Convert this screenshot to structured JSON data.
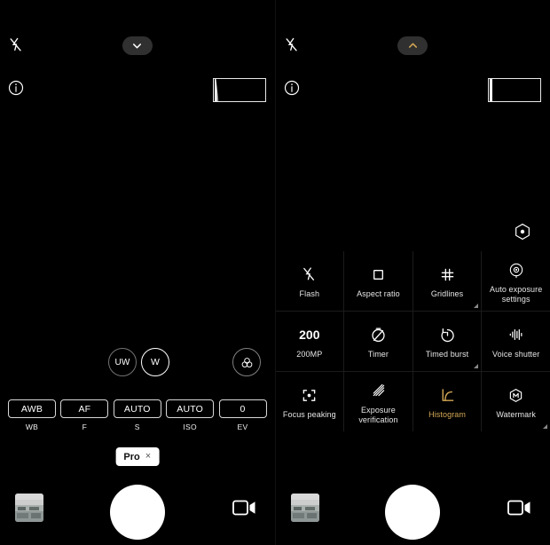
{
  "left_panel": {
    "top_bar": {
      "flash_icon": "flash-off-icon",
      "info_icon": "info-icon",
      "expand_toggle": {
        "icon": "chevron-down-icon",
        "state": "collapsed"
      },
      "histogram_overlay": "histogram-overlay"
    },
    "zoom": {
      "options": [
        {
          "label": "UW",
          "selected": false
        },
        {
          "label": "W",
          "selected": true
        }
      ],
      "filter_icon": "filters-icon"
    },
    "pro_controls": [
      {
        "value": "AWB",
        "label": "WB"
      },
      {
        "value": "AF",
        "label": "F"
      },
      {
        "value": "AUTO",
        "label": "S"
      },
      {
        "value": "AUTO",
        "label": "ISO"
      },
      {
        "value": "0",
        "label": "EV"
      }
    ],
    "mode_chip": {
      "label": "Pro",
      "close": "×"
    },
    "shutter_bar": {
      "gallery_icon": "gallery-thumbnail",
      "shutter_icon": "shutter-button",
      "video_icon": "video-camera-icon"
    }
  },
  "right_panel": {
    "top_bar": {
      "flash_icon": "flash-off-icon",
      "info_icon": "info-icon",
      "expand_toggle": {
        "icon": "chevron-up-icon",
        "state": "expanded"
      },
      "histogram_overlay": "histogram-overlay"
    },
    "ae_shortcut_icon": "auto-exposure-icon",
    "settings_grid": [
      [
        {
          "label": "Flash",
          "icon": "flash-off-icon",
          "active": false,
          "has_corner": false
        },
        {
          "label": "Aspect ratio",
          "icon": "square-icon",
          "active": false,
          "has_corner": false
        },
        {
          "label": "Gridlines",
          "icon": "gridlines-icon",
          "active": false,
          "has_corner": true
        },
        {
          "label": "Auto exposure settings",
          "icon": "auto-exposure-icon",
          "active": false,
          "has_corner": false
        }
      ],
      [
        {
          "label": "200MP",
          "icon": "200",
          "icon_type": "text",
          "active": false,
          "has_corner": false
        },
        {
          "label": "Timer",
          "icon": "timer-off-icon",
          "active": false,
          "has_corner": false
        },
        {
          "label": "Timed burst",
          "icon": "timed-burst-icon",
          "active": false,
          "has_corner": true
        },
        {
          "label": "Voice shutter",
          "icon": "voice-shutter-icon",
          "active": false,
          "has_corner": false
        }
      ],
      [
        {
          "label": "Focus peaking",
          "icon": "focus-peaking-icon",
          "active": false,
          "has_corner": false
        },
        {
          "label": "Exposure verification",
          "icon": "exposure-verification-icon",
          "active": false,
          "has_corner": false
        },
        {
          "label": "Histogram",
          "icon": "histogram-icon",
          "active": true,
          "has_corner": false
        },
        {
          "label": "Watermark",
          "icon": "watermark-icon",
          "active": false,
          "has_corner": true
        }
      ]
    ],
    "shutter_bar": {
      "gallery_icon": "gallery-thumbnail",
      "shutter_icon": "shutter-button",
      "video_icon": "video-camera-icon"
    }
  },
  "colors": {
    "background": "#000000",
    "accent_gold": "#d4a855",
    "text_primary": "#ffffff",
    "chip_background": "#ffffff",
    "divider": "#1b1b1b",
    "toggle_background": "#303030"
  }
}
